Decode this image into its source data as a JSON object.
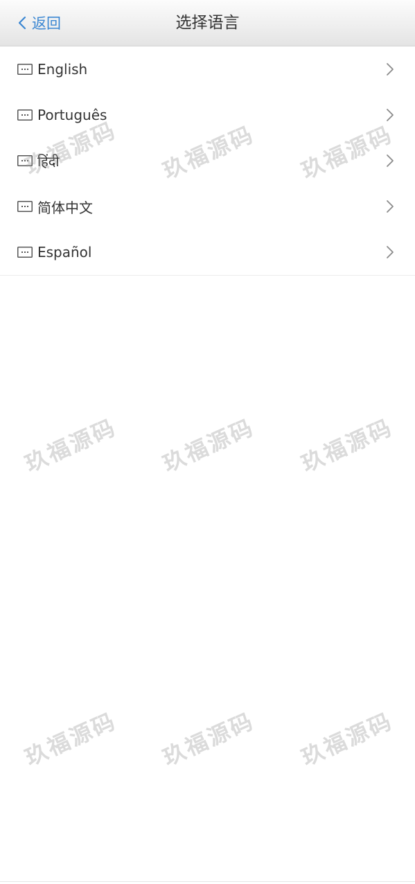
{
  "header": {
    "back_label": "返回",
    "title": "选择语言"
  },
  "languages": [
    {
      "label": "English"
    },
    {
      "label": "Português"
    },
    {
      "label": "हिंदी"
    },
    {
      "label": "简体中文"
    },
    {
      "label": "Español"
    }
  ],
  "watermark": {
    "text": "玖福源码"
  },
  "colors": {
    "accent": "#3a86d2",
    "text": "#333333",
    "icon": "#555555",
    "chevron": "#8a8a8a"
  }
}
